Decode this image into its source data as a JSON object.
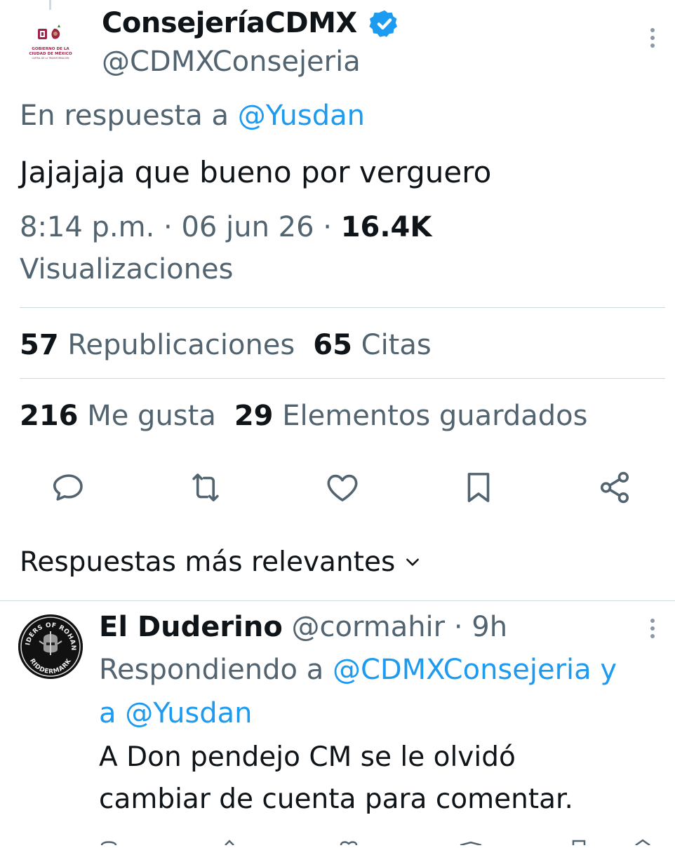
{
  "tweet": {
    "display_name": "ConsejeríaCDMX",
    "handle": "@CDMXConsejeria",
    "avatar_text": {
      "line1": "GOBIERNO DE LA",
      "line2": "CIUDAD DE MÉXICO",
      "line3": "CAPITAL DE LA TRANSFORMACIÓN"
    },
    "reply_prefix": "En respuesta a ",
    "reply_to": "@Yusdan",
    "text": "Jajajaja que bueno por verguero",
    "time": "8:14 p.m.",
    "sep": " · ",
    "date": "06 jun 26",
    "views_count": "16.4K",
    "views_label": "Visualizaciones",
    "reposts_count": "57",
    "reposts_label": "Republicaciones",
    "quotes_count": "65",
    "quotes_label": "Citas",
    "likes_count": "216",
    "likes_label": "Me gusta",
    "bookmarks_count": "29",
    "bookmarks_label": "Elementos guardados"
  },
  "actions": {
    "icons": [
      "reply-icon",
      "repost-icon",
      "like-icon",
      "bookmark-icon",
      "share-icon"
    ],
    "icon_color": "#536471"
  },
  "replies_header": {
    "label": "Respuestas más relevantes"
  },
  "reply": {
    "display_name": "El Duderino",
    "handle": "@cormahir",
    "sep": " · ",
    "time": "9h",
    "avatar_text": {
      "top": "RIDERS OF ROHAN",
      "bottom": "RIDDERMARK"
    },
    "context_prefix": "Respondiendo a ",
    "mention1": "@CDMXConsejeria",
    "connector1": " y",
    "connector2": "a ",
    "mention2": "@Yusdan",
    "text_line1": "A Don pendejo CM se le olvidó",
    "text_line2": "cambiar de cuenta para comentar."
  },
  "colors": {
    "text": "#0f1419",
    "secondary": "#536471",
    "accent": "#1d9bf0",
    "divider": "#cfd9de",
    "verified": "#1d9bf0"
  }
}
